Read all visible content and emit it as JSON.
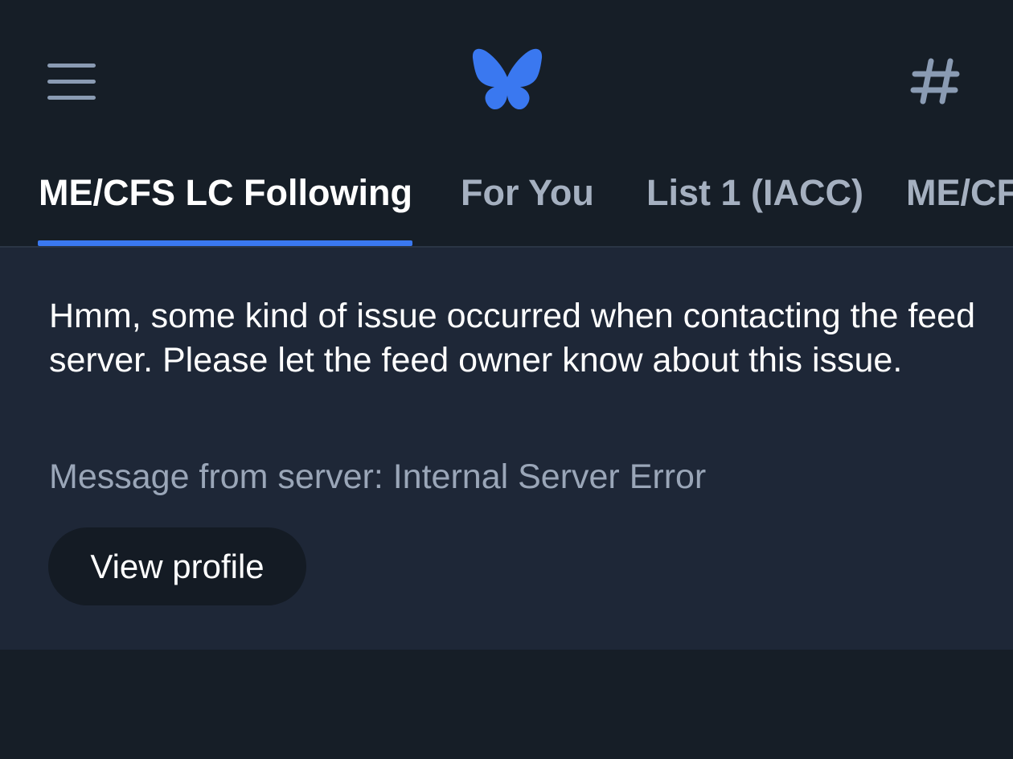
{
  "header": {
    "menu_icon": "hamburger-menu-icon",
    "logo_icon": "butterfly-logo-icon",
    "feeds_icon": "hash-icon",
    "logo_color": "#3a78f0"
  },
  "tabs": [
    {
      "label": "ME/CFS LC Following",
      "active": true
    },
    {
      "label": "For You",
      "active": false
    },
    {
      "label": "List 1 (IACC)",
      "active": false
    },
    {
      "label": "ME/CFS",
      "active": false
    }
  ],
  "feed_error": {
    "message": "Hmm, some kind of issue occurred when contacting the feed server. Please let the feed owner know about this issue.",
    "server_message": "Message from server: Internal Server Error",
    "button_label": "View profile"
  },
  "colors": {
    "background": "#161e27",
    "panel": "#1e2737",
    "accent": "#3a78f0"
  }
}
